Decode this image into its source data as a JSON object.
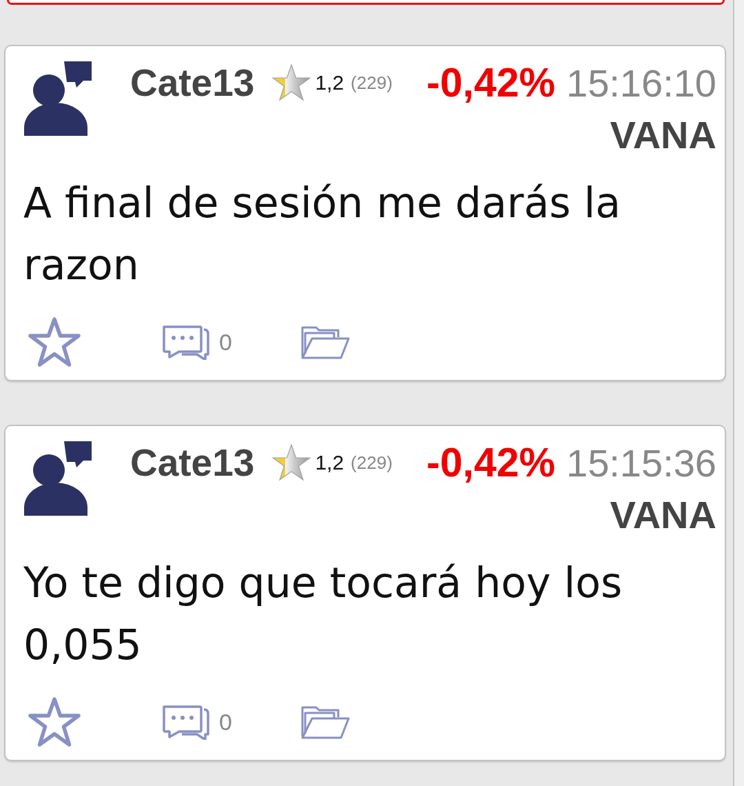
{
  "posts": [
    {
      "user": "Cate13",
      "rating": "1,2",
      "votes": "(229)",
      "change": "-0,42%",
      "time": "15:16:10",
      "ticker": "VANA",
      "message": "A final de sesión me darás la razon",
      "comments": "0"
    },
    {
      "user": "Cate13",
      "rating": "1,2",
      "votes": "(229)",
      "change": "-0,42%",
      "time": "15:15:36",
      "ticker": "VANA",
      "message": "Yo te digo que tocará hoy los 0,055",
      "comments": "0"
    }
  ]
}
